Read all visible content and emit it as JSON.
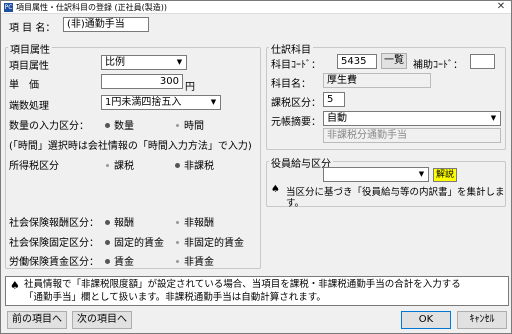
{
  "window": {
    "title": "項目属性・仕訳科目の登録 (正社員(製造))",
    "app_icon": "PC",
    "close_glyph": "✕"
  },
  "item_name": {
    "label": "項 目 名：",
    "value": "(非)通勤手当"
  },
  "attributes": {
    "group_title": "項目属性",
    "type_label": "項目属性",
    "type_value": "比例",
    "price_label": "単　価",
    "price_value": "300",
    "price_unit": "円",
    "rounding_label": "端数処理",
    "rounding_value": "1円未満四捨五入",
    "input_label": "数量の入力区分：",
    "input_options": [
      "数量",
      "時間"
    ],
    "input_selected": 0,
    "note": "(「時間」選択時は会社情報の「時間入力方法」で入力)",
    "tax_label": "所得税区分",
    "tax_options": [
      "課税",
      "非課税"
    ],
    "tax_selected": 1,
    "social_label": "社会保険報酬区分：",
    "social_options": [
      "報酬",
      "非報酬"
    ],
    "social_selected": 0,
    "fixed_label": "社会保険固定区分：",
    "fixed_options": [
      "固定的賃金",
      "非固定的賃金"
    ],
    "fixed_selected": 0,
    "labor_label": "労働保険賃金区分：",
    "labor_options": [
      "賃金",
      "非賃金"
    ],
    "labor_selected": 0
  },
  "journal": {
    "group_title": "仕訳科目",
    "code_label": "科目ｺｰﾄﾞ：",
    "code_value": "5435",
    "list_button": "一覧",
    "aux_label": "補助ｺｰﾄﾞ：",
    "aux_value": "",
    "name_label": "科目名：",
    "name_value": "厚生費",
    "tax_class_label": "課税区分：",
    "tax_class_value": "5",
    "desc_label": "元帳摘要：",
    "desc_value": "自動",
    "desc_auto_text": "非課税分通勤手当"
  },
  "officer": {
    "group_title": "役員給与区分",
    "select_value": "",
    "explain_button": "解説",
    "note_line1": "当区分に基づき「役員給与等の内訳書」を集計しま",
    "note_line2": "す。"
  },
  "info": {
    "line1": "社員情報で「非課税限度額」が設定されている場合、当項目を課税・非課税通勤手当の合計を入力する",
    "line2": "「通勤手当」欄として扱います。非課税通勤手当は自動計算されます。"
  },
  "buttons": {
    "prev": "前の項目へ",
    "next": "次の項目へ",
    "ok": "OK",
    "cancel": "ｷｬﾝｾﾙ"
  }
}
